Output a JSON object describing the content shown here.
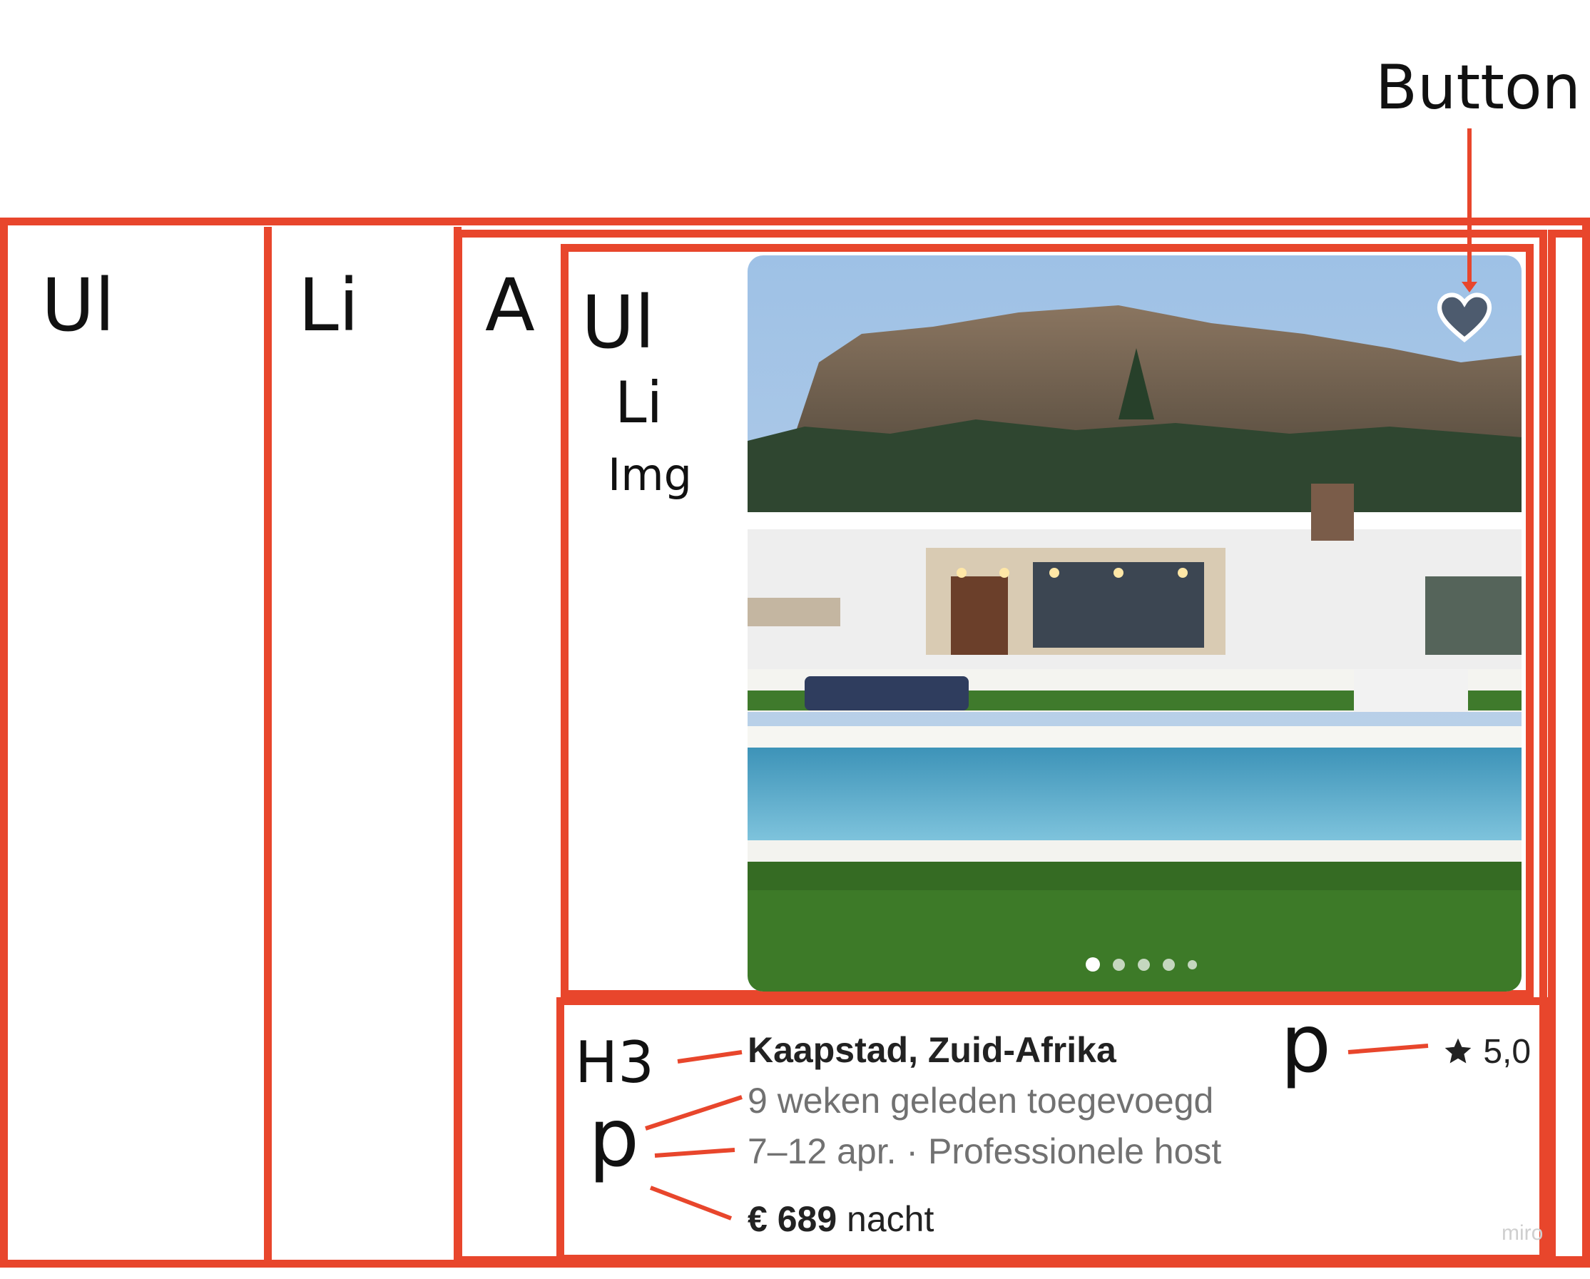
{
  "labels": {
    "outer_ul": "Ul",
    "outer_li": "Li",
    "anchor": "A",
    "inner_ul": "Ul",
    "inner_li": "Li",
    "img": "Img",
    "button": "Button",
    "h3": "H3",
    "p_left": "p",
    "p_right": "p"
  },
  "listing": {
    "title": "Kaapstad, Zuid-Afrika",
    "added": "9 weken geleden toegevoegd",
    "dates_host": "7–12 apr. · Professionele host",
    "price_amount": "€ 689",
    "price_unit": "nacht",
    "rating": "5,0"
  },
  "carousel": {
    "dot_count": 5,
    "active_index": 0
  },
  "colors": {
    "annotation": "#e8462c",
    "heart": "#4d5b6e"
  },
  "icons": [
    "heart-icon",
    "star-icon"
  ],
  "watermark": "miro"
}
